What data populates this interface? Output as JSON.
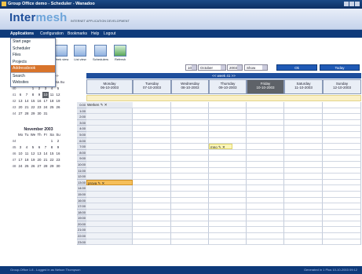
{
  "window": {
    "title": "Group Office demo - Scheduler - Wanadoo"
  },
  "header": {
    "logo_main": "Inter",
    "logo_accent": "mesh",
    "tagline": "INTERNET APPLICATION DEVELOPMENT"
  },
  "menu": [
    {
      "label": "Applications"
    },
    {
      "label": "Configuration"
    },
    {
      "label": "Bookmarks"
    },
    {
      "label": "Help"
    },
    {
      "label": "Logout"
    }
  ],
  "dropdown": [
    {
      "label": "Start page"
    },
    {
      "label": "Scheduler"
    },
    {
      "label": "Files"
    },
    {
      "label": "Projects"
    },
    {
      "label": "Addressbook",
      "selected": true
    },
    {
      "label": "Search"
    },
    {
      "label": "Websites"
    }
  ],
  "toolbar": [
    {
      "label": "Week view",
      "icon": "week-view-icon"
    },
    {
      "label": "List view",
      "icon": "list-view-icon"
    },
    {
      "label": "Schedulers",
      "icon": "schedulers-icon"
    },
    {
      "label": "Refresh",
      "icon": "refresh-icon"
    }
  ],
  "filters": {
    "day": "10",
    "month": "October",
    "year": "2003",
    "view": "Show",
    "ok_label": "Ok",
    "today_label": "Today"
  },
  "week_nav": "<< week 41 >>",
  "days": [
    {
      "name": "Monday",
      "date": "06-10-2003"
    },
    {
      "name": "Tuesday",
      "date": "07-10-2003"
    },
    {
      "name": "Wednesday",
      "date": "08-10-2003"
    },
    {
      "name": "Thursday",
      "date": "09-10-2003"
    },
    {
      "name": "Friday",
      "date": "10-10-2003",
      "today": true
    },
    {
      "name": "Saturday",
      "date": "11-10-2003"
    },
    {
      "name": "Sunday",
      "date": "12-10-2003"
    }
  ],
  "hours": [
    "0:00",
    "1:00",
    "2:00",
    "3:00",
    "4:00",
    "5:00",
    "6:00",
    "7:00",
    "8:00",
    "9:00",
    "10:00",
    "11:00",
    "12:00",
    "13:00",
    "14:00",
    "15:00",
    "16:00",
    "17:00",
    "18:00",
    "19:00",
    "20:00",
    "21:00",
    "22:00",
    "23:00"
  ],
  "events": [
    {
      "title": "Werken",
      "day": 0,
      "start": 0
    },
    {
      "title": "mno",
      "day": 3,
      "start": 7
    },
    {
      "title": "prova",
      "day": 0,
      "start": 13
    }
  ],
  "mini_cal_nav": ">>",
  "mini_cal_weekday_fragment": "Sa Su",
  "oct_weeks": [
    [
      "40",
      "",
      "",
      "1",
      "2",
      "3",
      "4",
      "5"
    ],
    [
      "41",
      "6",
      "7",
      "8",
      "9",
      "10",
      "11",
      "12"
    ],
    [
      "42",
      "13",
      "14",
      "15",
      "16",
      "17",
      "18",
      "19"
    ],
    [
      "43",
      "20",
      "21",
      "22",
      "23",
      "24",
      "25",
      "26"
    ],
    [
      "44",
      "27",
      "28",
      "29",
      "30",
      "31",
      "",
      ""
    ]
  ],
  "nov_title": "November 2003",
  "nov_weekdays": [
    "",
    "Mo",
    "Tu",
    "We",
    "Th",
    "Fr",
    "Sa",
    "Su"
  ],
  "nov_weeks": [
    [
      "44",
      "",
      "",
      "",
      "",
      "",
      "1",
      "2"
    ],
    [
      "45",
      "3",
      "4",
      "5",
      "6",
      "7",
      "8",
      "9"
    ],
    [
      "46",
      "10",
      "11",
      "12",
      "13",
      "14",
      "15",
      "16"
    ],
    [
      "47",
      "17",
      "18",
      "19",
      "20",
      "21",
      "22",
      "23"
    ],
    [
      "48",
      "24",
      "25",
      "26",
      "27",
      "28",
      "29",
      "30"
    ]
  ],
  "footer_left": "Group-Office 1.8 - Logged in as Nelson Thompson",
  "footer_right": "Generated in 1 Plus 10-10-2003 09:12"
}
